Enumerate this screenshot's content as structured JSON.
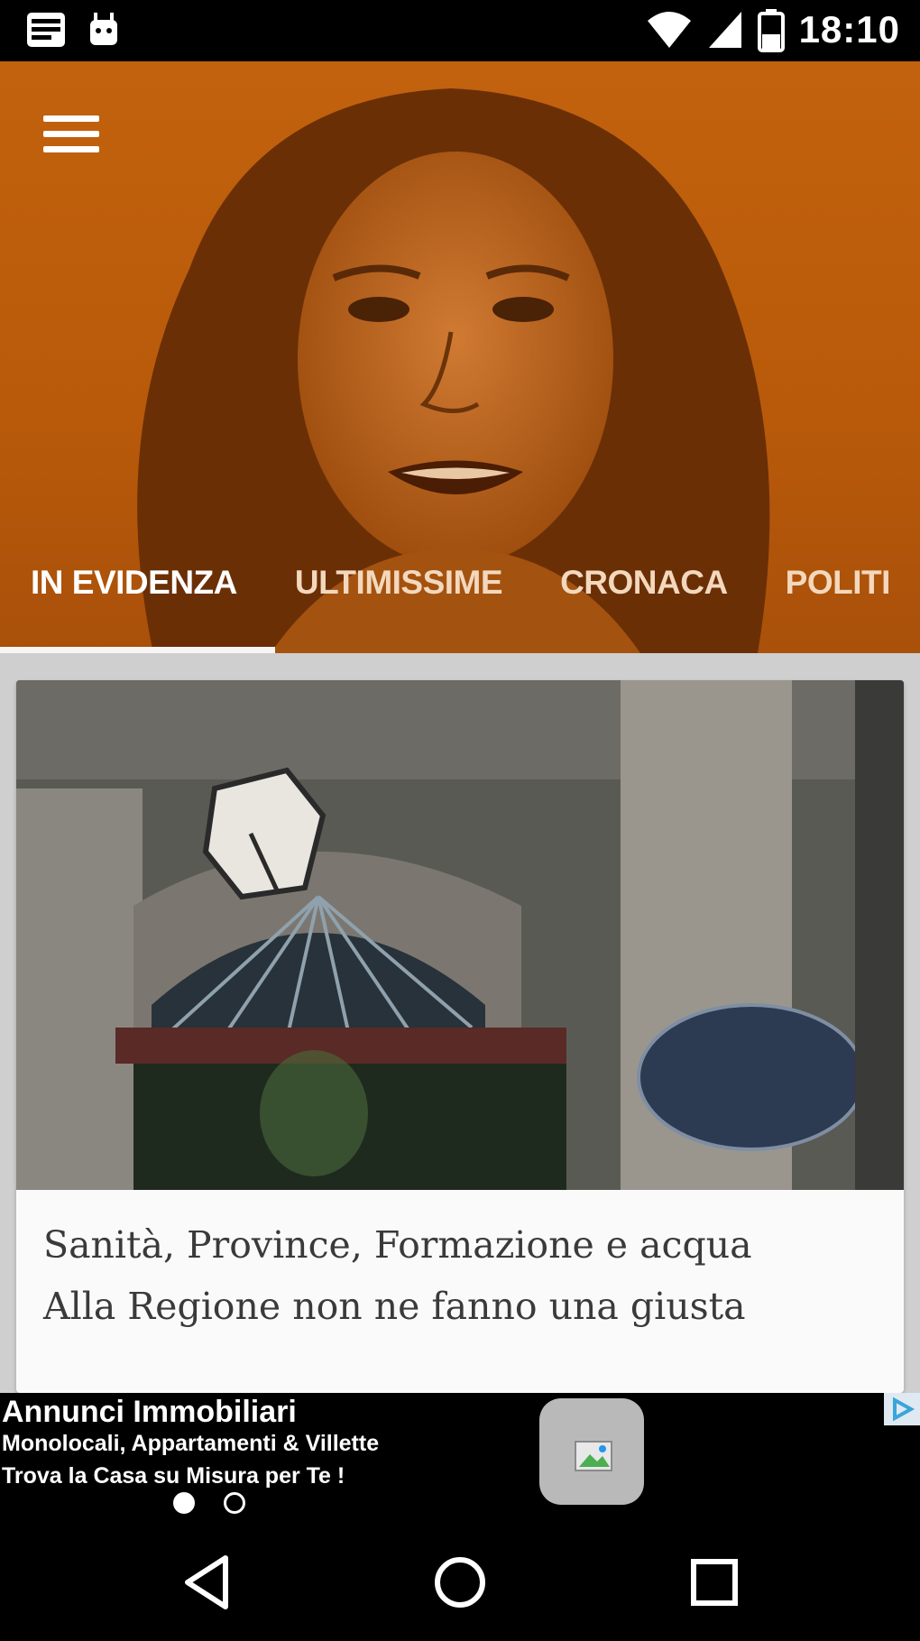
{
  "status_bar": {
    "time": "18:10",
    "icons": [
      "sms-icon",
      "android-icon",
      "wifi-icon",
      "signal-icon",
      "battery-icon"
    ]
  },
  "header": {
    "menu_icon": "hamburger-menu-icon",
    "accent_color": "#c2620e",
    "tabs": [
      {
        "label": "IN EVIDENZA",
        "active": true
      },
      {
        "label": "ULTIMISSIME",
        "active": false
      },
      {
        "label": "CRONACA",
        "active": false
      },
      {
        "label": "POLITI",
        "active": false
      }
    ]
  },
  "article": {
    "headline_line1": "Sanità, Province, Formazione e acqua",
    "headline_line2": "Alla Regione non ne fanno una giusta"
  },
  "ad": {
    "title": "Annunci Immobiliari",
    "line1": "Monolocali, Appartamenti & Villette",
    "line2": "Trova la Casa su Misura per Te !",
    "choices_icon": "adchoices-icon",
    "page_dots": 2,
    "active_dot": 0
  },
  "nav_bar": {
    "buttons": [
      "back-icon",
      "home-icon",
      "recents-icon"
    ]
  }
}
